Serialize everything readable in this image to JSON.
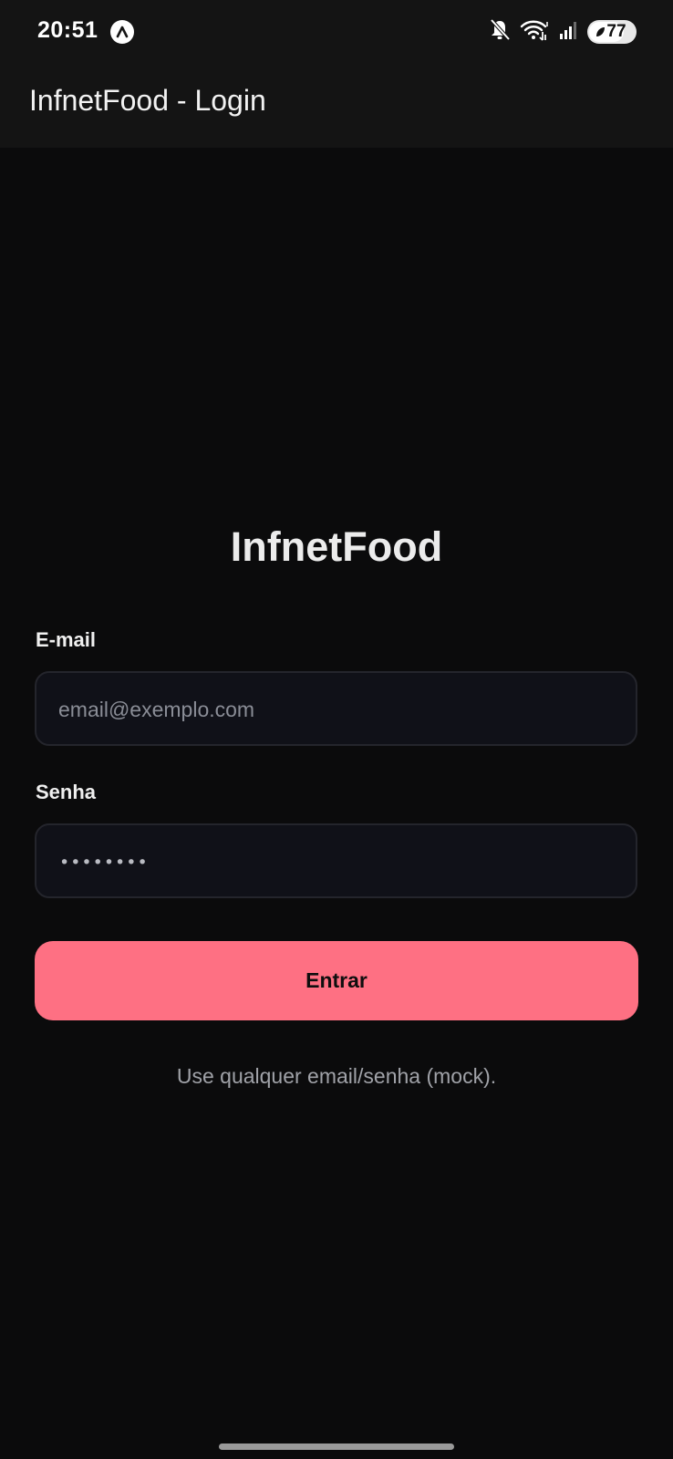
{
  "status_bar": {
    "time": "20:51",
    "battery_level": "77",
    "battery_fraction": 0.77,
    "icons": [
      "a-notification-icon",
      "mute-icon",
      "wifi-icon",
      "signal-icon",
      "battery-icon"
    ]
  },
  "app_bar": {
    "title": "InfnetFood - Login"
  },
  "login": {
    "brand": "InfnetFood",
    "email_label": "E-mail",
    "email_placeholder": "email@exemplo.com",
    "password_label": "Senha",
    "password_value": "••••••••",
    "submit_label": "Entrar",
    "hint": "Use qualquer email/senha (mock)."
  },
  "colors": {
    "background": "#0b0b0c",
    "bar": "#141414",
    "accent": "#fe7083",
    "field_background": "#101118",
    "field_border": "#24252c"
  }
}
